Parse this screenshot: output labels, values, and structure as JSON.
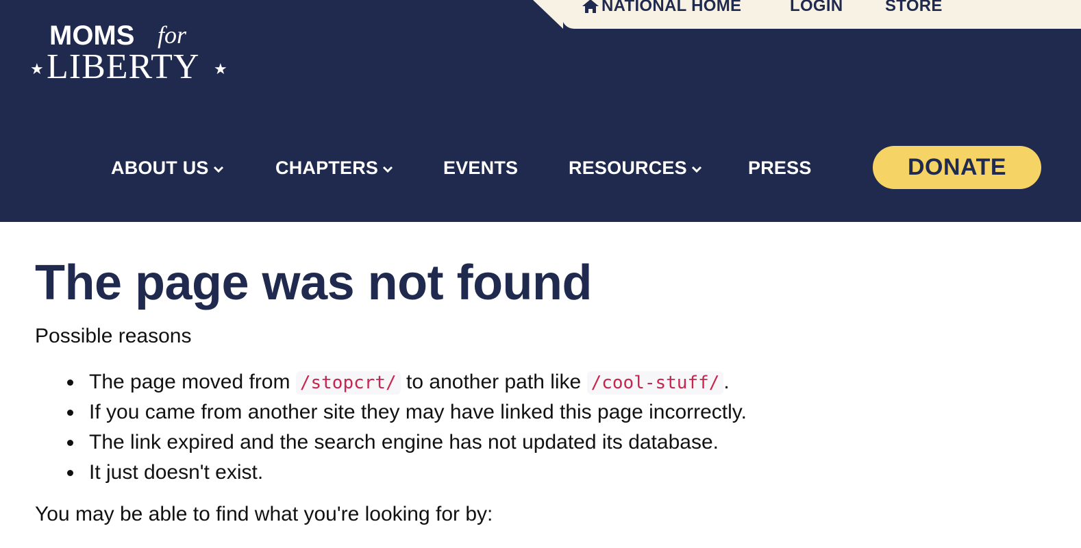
{
  "utility_nav": {
    "home": "NATIONAL HOME",
    "login": "LOGIN",
    "store": "STORE"
  },
  "logo": {
    "line1": "MOMS",
    "line1_script": "for",
    "line2": "LIBERTY"
  },
  "main_nav": {
    "about": "ABOUT US",
    "chapters": "CHAPTERS",
    "events": "EVENTS",
    "resources": "RESOURCES",
    "press": "PRESS",
    "donate": "DONATE"
  },
  "content": {
    "title": "The page was not found",
    "possible_reasons": "Possible reasons",
    "reason1_before": "The page moved from ",
    "reason1_code1": "/stopcrt/",
    "reason1_middle": " to another path like ",
    "reason1_code2": "/cool-stuff/",
    "reason1_after": ".",
    "reason2": "If you came from another site they may have linked this page incorrectly.",
    "reason3": "The link expired and the search engine has not updated its database.",
    "reason4": "It just doesn't exist.",
    "find_text": "You may be able to find what you're looking for by:"
  },
  "colors": {
    "navy": "#1f2a4e",
    "cream": "#f7f2e3",
    "gold": "#f6d365",
    "code_red": "#c7254e"
  },
  "icons": {
    "home": "home-icon",
    "chevron": "chevron-down-icon",
    "star": "star-icon"
  }
}
